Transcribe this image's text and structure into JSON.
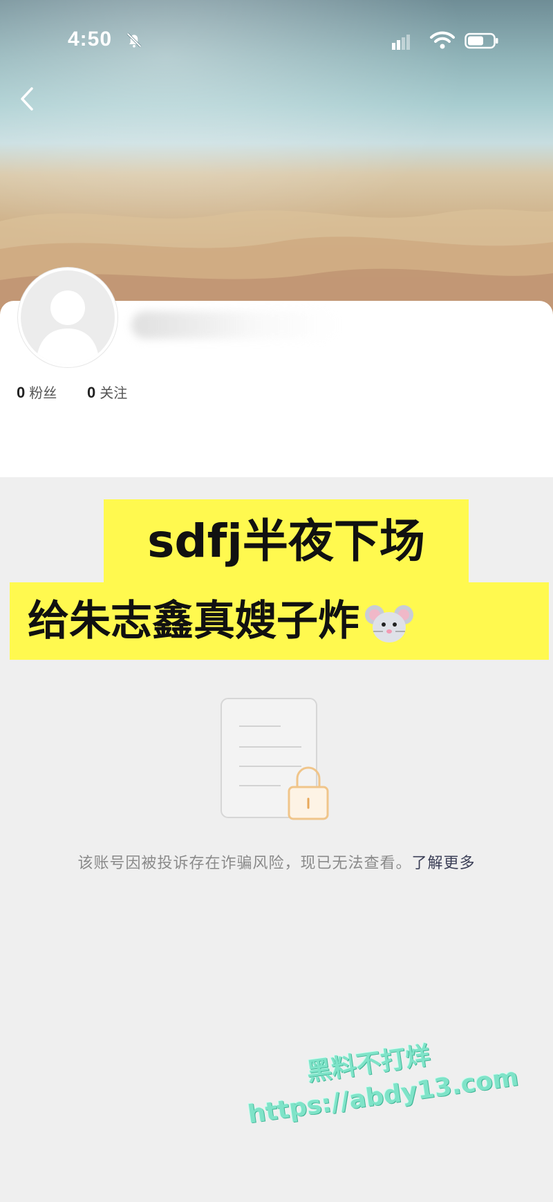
{
  "status_bar": {
    "time": "4:50"
  },
  "profile": {
    "fans_count": "0",
    "fans_label": "粉丝",
    "following_count": "0",
    "following_label": "关注"
  },
  "caption": {
    "line1": "sdfj半夜下场",
    "line2": "给朱志鑫真嫂子炸"
  },
  "notice": {
    "text": "该账号因被投诉存在诈骗风险，现已无法查看。",
    "link": "了解更多"
  },
  "watermark": {
    "line1": "黑料不打烊",
    "line2": "https://abdy13.com"
  },
  "icons": [
    "bell-mute-icon",
    "signal-icon",
    "wifi-icon",
    "battery-icon",
    "back-icon",
    "avatar-placeholder-icon",
    "mouse-emoji-icon",
    "locked-document-icon"
  ],
  "colors": {
    "caption_bg": "#fff94f",
    "link": "#3b3f57",
    "watermark": "#7fe3c8"
  }
}
